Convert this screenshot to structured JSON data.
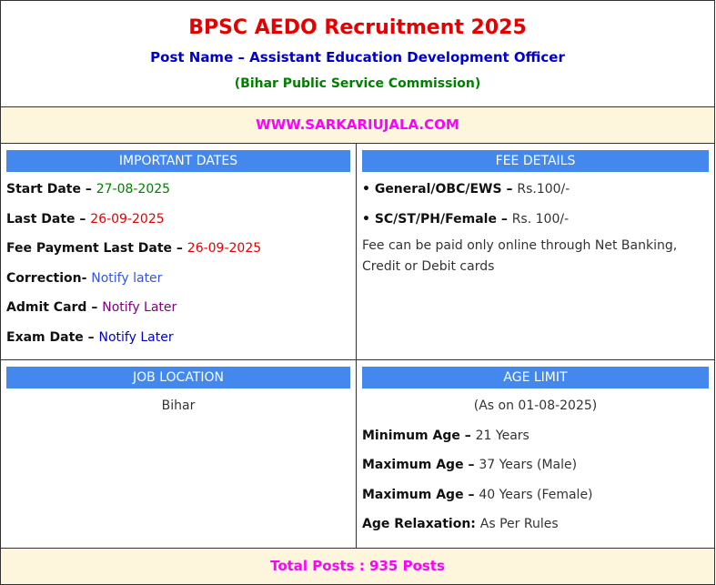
{
  "header": {
    "title": "BPSC AEDO Recruitment 2025",
    "post_name": "Post Name – Assistant Education Development Officer",
    "organization": "(Bihar Public Service Commission)"
  },
  "website": "WWW.SARKARIUJALA.COM",
  "important_dates": {
    "heading": "IMPORTANT DATES",
    "items": [
      {
        "label": "Start Date – ",
        "value": "27-08-2025"
      },
      {
        "label": "Last Date – ",
        "value": "26-09-2025"
      },
      {
        "label": "Fee Payment Last Date – ",
        "value": "26-09-2025"
      },
      {
        "label": "Correction- ",
        "value": "Notify later"
      },
      {
        "label": "Admit Card – ",
        "value": "Notify Later"
      },
      {
        "label": "Exam Date – ",
        "value": "Notify Later"
      }
    ]
  },
  "fee_details": {
    "heading": "FEE DETAILS",
    "items": [
      {
        "label": "• General/OBC/EWS – ",
        "value": "Rs.100/-"
      },
      {
        "label": "• SC/ST/PH/Female – ",
        "value": "Rs. 100/-"
      }
    ],
    "note": "Fee can be paid only online through Net Banking, Credit or Debit cards"
  },
  "job_location": {
    "heading": "JOB LOCATION",
    "value": "Bihar"
  },
  "age_limit": {
    "heading": "AGE LIMIT",
    "as_on": "(As on 01-08-2025)",
    "items": [
      {
        "label": "Minimum Age – ",
        "value": "21 Years"
      },
      {
        "label": "Maximum Age – ",
        "value": "37 Years (Male)"
      },
      {
        "label": "Maximum Age – ",
        "value": "40 Years (Female)"
      },
      {
        "label": "Age Relaxation: ",
        "value": "As Per Rules"
      }
    ]
  },
  "total_posts": "Total Posts : 935 Posts",
  "colors": {
    "title": "#e60000",
    "post_name": "#0000cc",
    "organization": "#008000",
    "highlight": "#ff00ff",
    "section_bar": "#4488ee",
    "row_background": "#fdf6dd"
  }
}
